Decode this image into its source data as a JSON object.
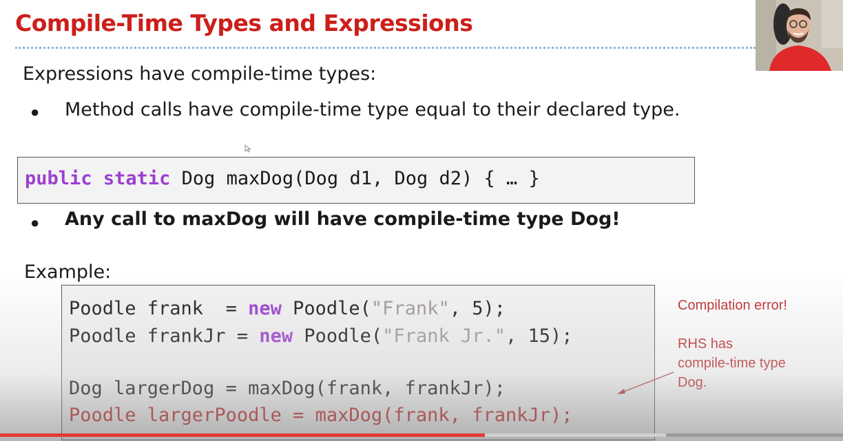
{
  "slide": {
    "title": "Compile-Time Types and Expressions",
    "intro": "Expressions have compile-time types:",
    "bullet_1": "Method calls have compile-time type equal to their declared type.",
    "bullet_2": "Any call to maxDog will have compile-time type Dog!",
    "bullet_symbol": "●",
    "example_label": "Example:"
  },
  "signature": {
    "kw_public": "public",
    "kw_static": "static",
    "rest": " Dog maxDog(Dog d1, Dog d2) { … }"
  },
  "example_code": {
    "line1_a": "Poodle frank  = ",
    "line1_kw": "new",
    "line1_b": " Poodle(",
    "line1_str": "\"Frank\"",
    "line1_c": ", 5);",
    "line2_a": "Poodle frankJr = ",
    "line2_kw": "new",
    "line2_b": " Poodle(",
    "line2_str": "\"Frank Jr.\"",
    "line2_c": ", 15);",
    "line3": "Dog largerDog = maxDog(frank, frankJr);",
    "line4": "Poodle largerPoodle = maxDog(frank, frankJr);"
  },
  "annotations": {
    "error": "Compilation error!",
    "rhs_1": "RHS has",
    "rhs_2": "compile-time type",
    "rhs_3": "Dog."
  },
  "video": {
    "progress_fraction": 0.575,
    "buffered_fraction": 0.79
  },
  "colors": {
    "title": "#cc1f1a",
    "keyword": "#9b3fd1",
    "string": "#a09898",
    "error": "#c0282a",
    "progress": "#e53935"
  }
}
